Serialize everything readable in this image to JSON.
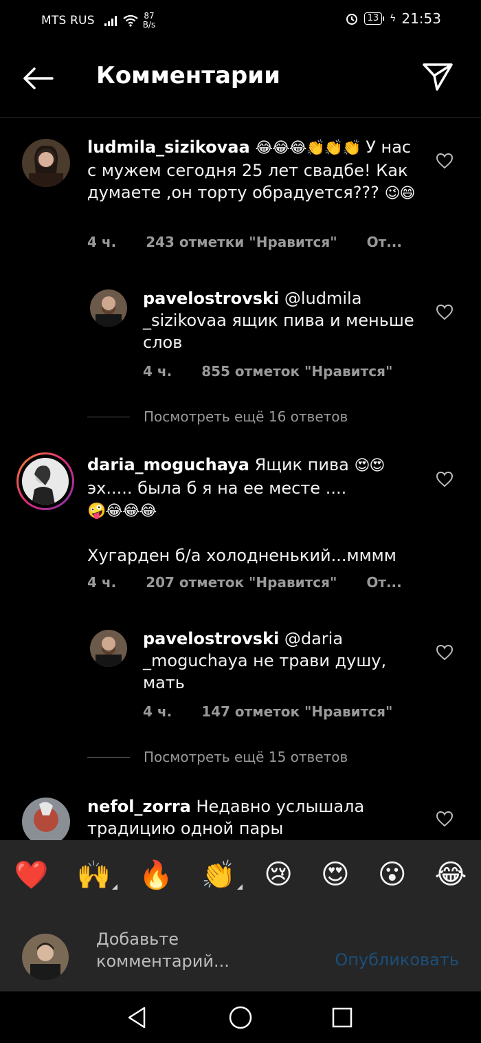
{
  "status_bar": {
    "carrier": "MTS RUS",
    "speed_value": "87",
    "speed_unit": "B/s",
    "battery": "13",
    "time": "21:53"
  },
  "header": {
    "title": "Комментарии",
    "back_icon": "arrow-left-icon",
    "send_icon": "send-icon"
  },
  "comments": [
    {
      "username": "ludmila_sizikovaa",
      "emoji_before": "😂😂😂👏👏👏",
      "text": "У нас с мужем сегодня 25 лет свадбе! Как думаете ,он торту обрадуется???",
      "emoji_after": "😉😄",
      "time": "4 ч.",
      "likes": "243 отметки \"Нравится\"",
      "reply_action": "От..."
    },
    {
      "username": "pavelostrovski",
      "text": "@ludmila _sizikovaa ящик пива и меньше слов",
      "time": "4 ч.",
      "likes": "855 отметок \"Нравится\""
    },
    {
      "view_more": "Посмотреть ещё 16 ответов"
    },
    {
      "username": "daria_moguchaya",
      "text": "Ящик пива",
      "emoji_1": "😍😍",
      "text_2": "эх..... была б я на ее месте ....",
      "emoji_2": "🤪😂😂😂",
      "text_3": "Хугарден б/а холодненький...мммм",
      "time": "4 ч.",
      "likes": "207 отметок \"Нравится\"",
      "reply_action": "От..."
    },
    {
      "username": "pavelostrovski",
      "text": "@daria _moguchaya не трави душу, мать",
      "time": "4 ч.",
      "likes": "147 отметок \"Нравится\""
    },
    {
      "view_more": "Посмотреть ещё 15 ответов"
    },
    {
      "username": "nefol_zorra",
      "text": "Недавно услышала традицию одной пары"
    }
  ],
  "reactions": [
    "❤️",
    "🙌",
    "🔥",
    "👏",
    "😢",
    "😍",
    "😮",
    "😂"
  ],
  "composer": {
    "placeholder": "Добавьте комментарий...",
    "post_label": "Опубликовать"
  },
  "colors": {
    "background": "#000000",
    "panel": "#262626",
    "muted_text": "#9a9a9a",
    "post_button": "#1b4f7a"
  }
}
